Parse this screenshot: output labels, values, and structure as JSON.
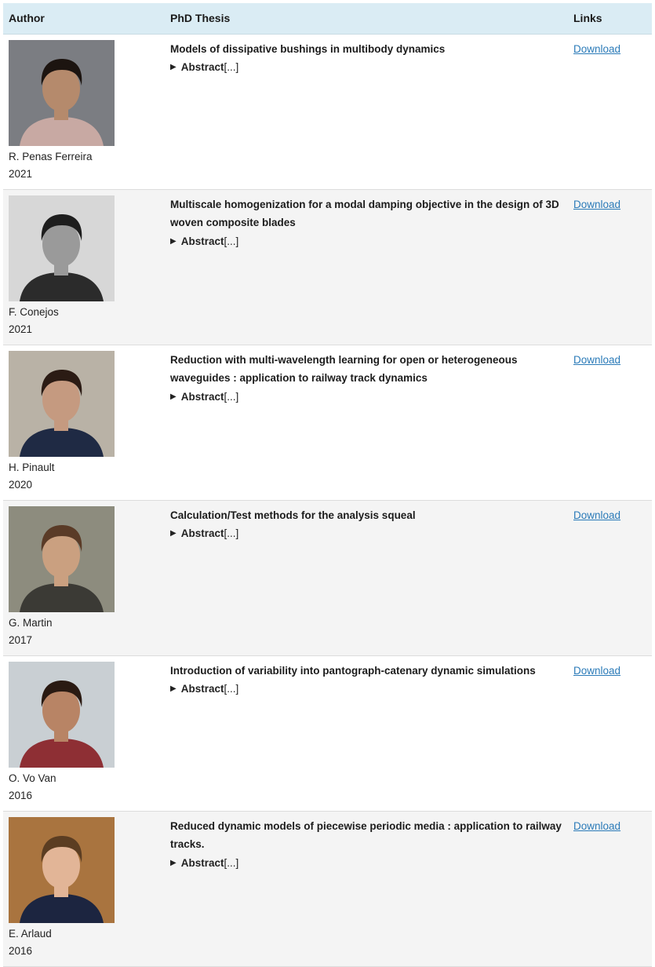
{
  "header": {
    "author": "Author",
    "thesis": "PhD Thesis",
    "links": "Links"
  },
  "rows": [
    {
      "name": "R. Penas Ferreira",
      "year": "2021",
      "title": "Models of dissipative bushings in multibody dynamics",
      "abstract_label": "Abstract",
      "abstract_more": "[...]",
      "link": "Download",
      "photo": {
        "bg": "#7b7d82",
        "skin": "#b58a6c",
        "hair": "#1c1410",
        "shirt": "#c8a9a3"
      }
    },
    {
      "name": "F. Conejos",
      "year": "2021",
      "title": "Multiscale homogenization for a modal damping objective in the design of 3D woven composite blades",
      "abstract_label": "Abstract",
      "abstract_more": "[...]",
      "link": "Download",
      "photo": {
        "bg": "#d7d7d7",
        "skin": "#9a9a9a",
        "hair": "#1e1e1e",
        "shirt": "#2b2b2b"
      }
    },
    {
      "name": "H. Pinault",
      "year": "2020",
      "title": "Reduction with multi-wavelength learning for open or heterogeneous waveguides : application to railway track dynamics",
      "abstract_label": "Abstract",
      "abstract_more": "[...]",
      "link": "Download",
      "photo": {
        "bg": "#b9b2a6",
        "skin": "#c59a80",
        "hair": "#2b1b14",
        "shirt": "#1f2a44"
      }
    },
    {
      "name": "G. Martin",
      "year": "2017",
      "title": "Calculation/Test methods for the analysis squeal",
      "abstract_label": "Abstract",
      "abstract_more": "[...]",
      "link": "Download",
      "photo": {
        "bg": "#8d8c7e",
        "skin": "#caa080",
        "hair": "#5a3b27",
        "shirt": "#3b3a35"
      }
    },
    {
      "name": "O. Vo Van",
      "year": "2016",
      "title": "Introduction of variability into pantograph-catenary dynamic simulations",
      "abstract_label": "Abstract",
      "abstract_more": "[...]",
      "link": "Download",
      "photo": {
        "bg": "#c9cfd3",
        "skin": "#b88465",
        "hair": "#2a1a12",
        "shirt": "#8e2f34"
      }
    },
    {
      "name": "E. Arlaud",
      "year": "2016",
      "title": "Reduced dynamic models of piecewise periodic media : application to railway tracks.",
      "abstract_label": "Abstract",
      "abstract_more": "[...]",
      "link": "Download",
      "photo": {
        "bg": "#a9743f",
        "skin": "#e2b597",
        "hair": "#5b3d22",
        "shirt": "#1c2540"
      }
    }
  ]
}
